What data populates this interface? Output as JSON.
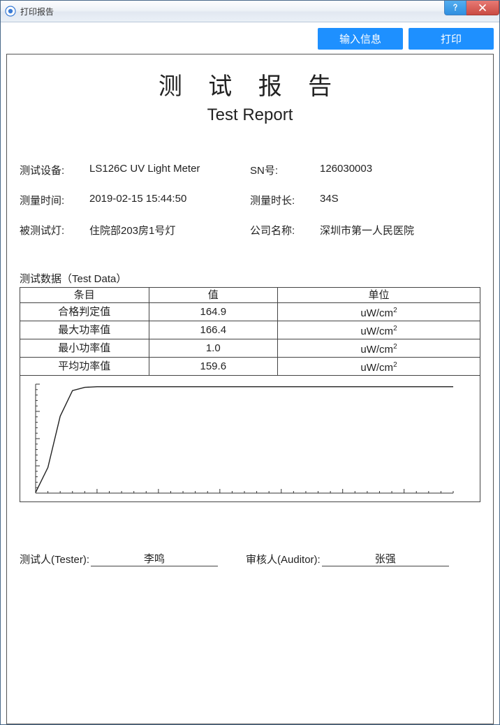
{
  "window": {
    "title": "打印报告"
  },
  "toolbar": {
    "input_info_label": "输入信息",
    "print_label": "打印"
  },
  "report": {
    "title_cn": "测 试 报 告",
    "title_en": "Test Report",
    "info": {
      "device_label": "测试设备:",
      "device_value": "LS126C UV Light Meter",
      "sn_label": "SN号:",
      "sn_value": "126030003",
      "time_label": "测量时间:",
      "time_value": "2019-02-15 15:44:50",
      "duration_label": "测量时长:",
      "duration_value": "34S",
      "lamp_label": "被测试灯:",
      "lamp_value": "住院部203房1号灯",
      "company_label": "公司名称:",
      "company_value": "深圳市第一人民医院"
    },
    "test_data_label": "测试数据（Test Data）",
    "table": {
      "headers": {
        "item": "条目",
        "value": "值",
        "unit": "单位"
      },
      "rows": [
        {
          "item": "合格判定值",
          "value": "164.9",
          "unit_base": "uW/cm",
          "unit_sup": "2"
        },
        {
          "item": "最大功率值",
          "value": "166.4",
          "unit_base": "uW/cm",
          "unit_sup": "2"
        },
        {
          "item": "最小功率值",
          "value": "1.0",
          "unit_base": "uW/cm",
          "unit_sup": "2"
        },
        {
          "item": "平均功率值",
          "value": "159.6",
          "unit_base": "uW/cm",
          "unit_sup": "2"
        }
      ]
    },
    "signatures": {
      "tester_label": "测试人(Tester):",
      "tester_value": "李鸣",
      "auditor_label": "审核人(Auditor):",
      "auditor_value": "张强"
    }
  },
  "chart_data": {
    "type": "line",
    "x": [
      0,
      1,
      2,
      3,
      4,
      5,
      6,
      7,
      8,
      9,
      10,
      11,
      12,
      13,
      14,
      15,
      16,
      17,
      18,
      19,
      20,
      21,
      22,
      23,
      24,
      25,
      26,
      27,
      28,
      29,
      30,
      31,
      32,
      33,
      34
    ],
    "values": [
      1,
      40,
      120,
      160,
      165,
      166,
      166,
      166,
      166,
      166,
      166,
      166,
      166,
      166,
      166,
      166,
      166,
      166,
      166,
      166,
      166,
      166,
      166,
      166,
      166,
      166,
      166,
      166,
      166,
      166,
      166,
      166,
      166,
      166,
      166
    ],
    "ylim": [
      0,
      170
    ],
    "xlim": [
      0,
      34
    ],
    "title": "",
    "xlabel": "",
    "ylabel": ""
  }
}
